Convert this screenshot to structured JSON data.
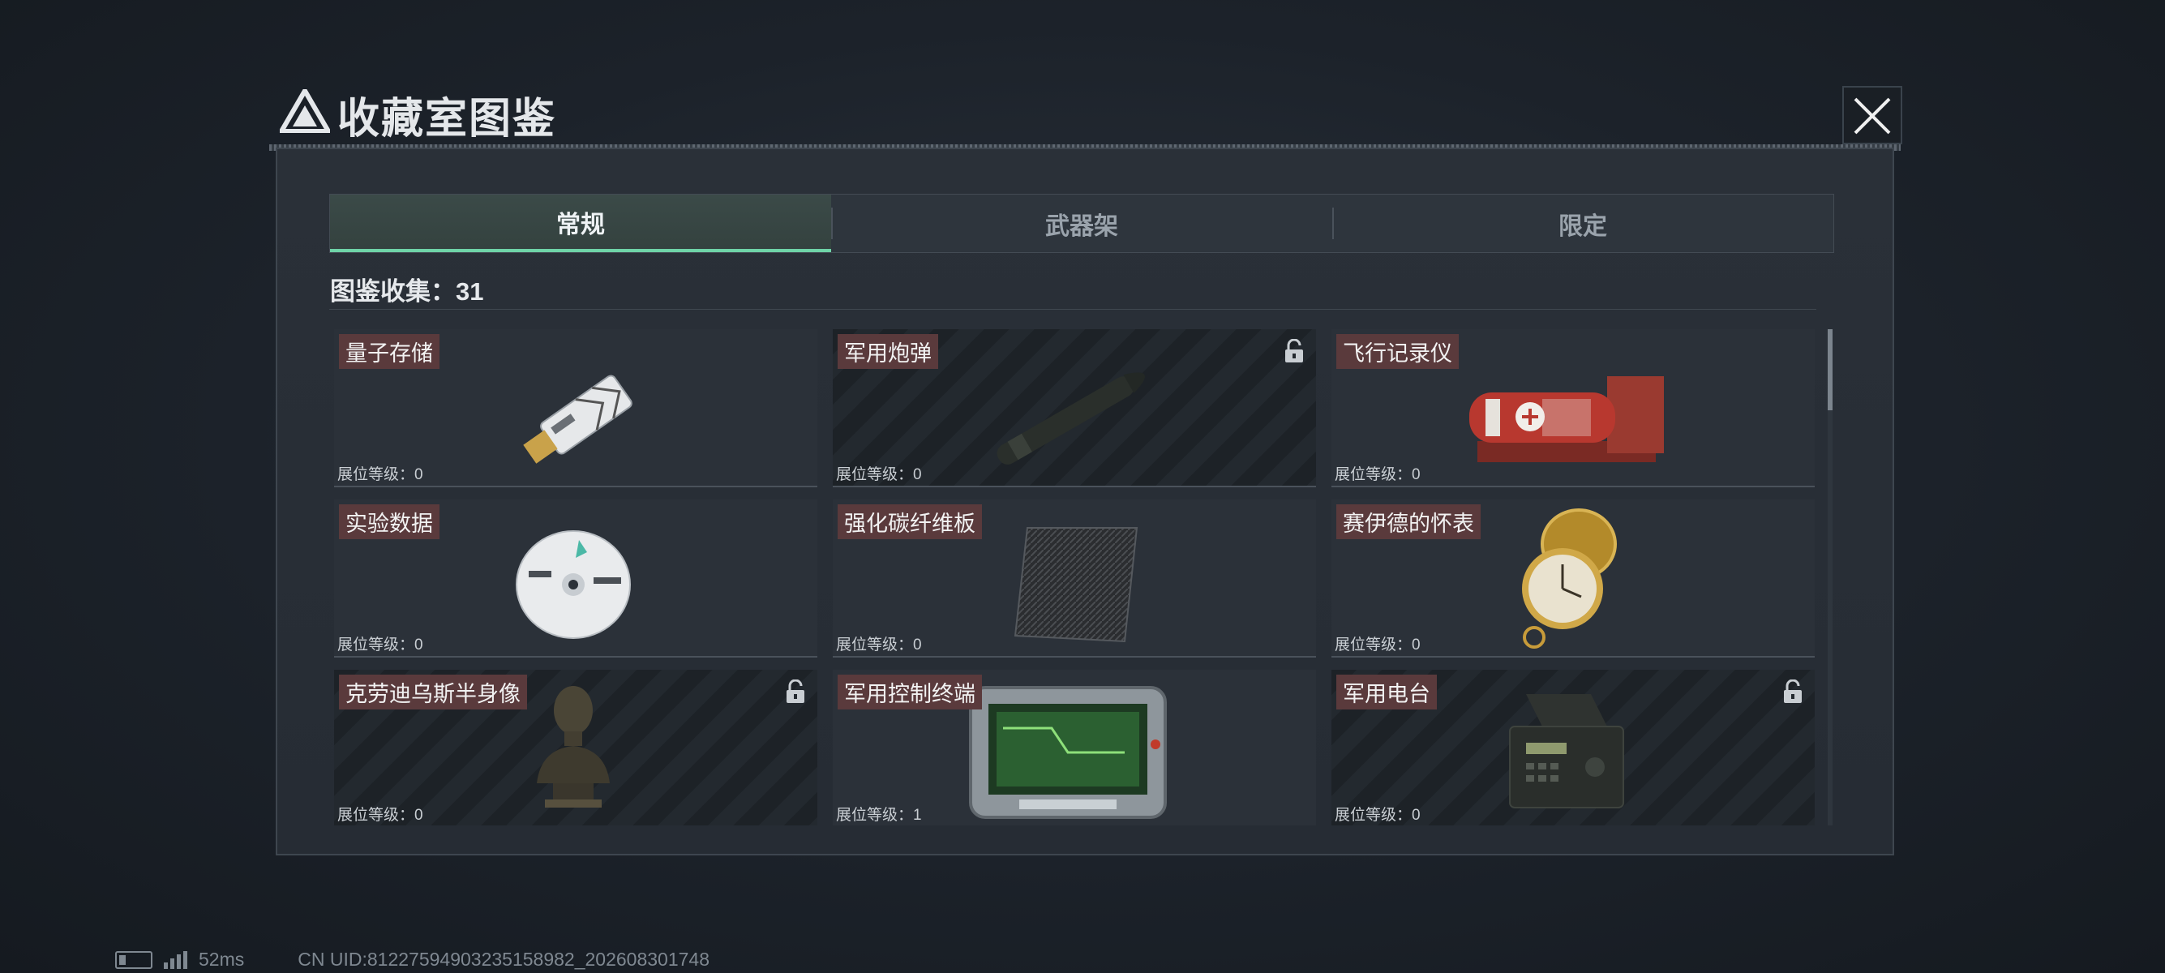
{
  "header": {
    "title": "收藏室图鉴"
  },
  "tabs": [
    {
      "label": "常规",
      "active": true
    },
    {
      "label": "武器架",
      "active": false
    },
    {
      "label": "限定",
      "active": false
    }
  ],
  "collection": {
    "label": "图鉴收集：",
    "count": "31"
  },
  "cards": [
    {
      "name": "量子存储",
      "level": "展位等级：0",
      "locked": false,
      "icon": "usb-drive"
    },
    {
      "name": "军用炮弹",
      "level": "展位等级：0",
      "locked": true,
      "icon": "artillery-shell"
    },
    {
      "name": "飞行记录仪",
      "level": "展位等级：0",
      "locked": false,
      "icon": "flight-recorder"
    },
    {
      "name": "实验数据",
      "level": "展位等级：0",
      "locked": false,
      "icon": "disc"
    },
    {
      "name": "强化碳纤维板",
      "level": "展位等级：0",
      "locked": false,
      "icon": "carbon-plate"
    },
    {
      "name": "赛伊德的怀表",
      "level": "展位等级：0",
      "locked": false,
      "icon": "pocket-watch"
    },
    {
      "name": "克劳迪乌斯半身像",
      "level": "展位等级：0",
      "locked": true,
      "icon": "bust"
    },
    {
      "name": "军用控制终端",
      "level": "展位等级：1",
      "locked": false,
      "icon": "control-terminal"
    },
    {
      "name": "军用电台",
      "level": "展位等级：0",
      "locked": true,
      "icon": "radio"
    }
  ],
  "status": {
    "ping": "52ms",
    "uid": "CN UID:81227594903235158982_202608301748"
  }
}
